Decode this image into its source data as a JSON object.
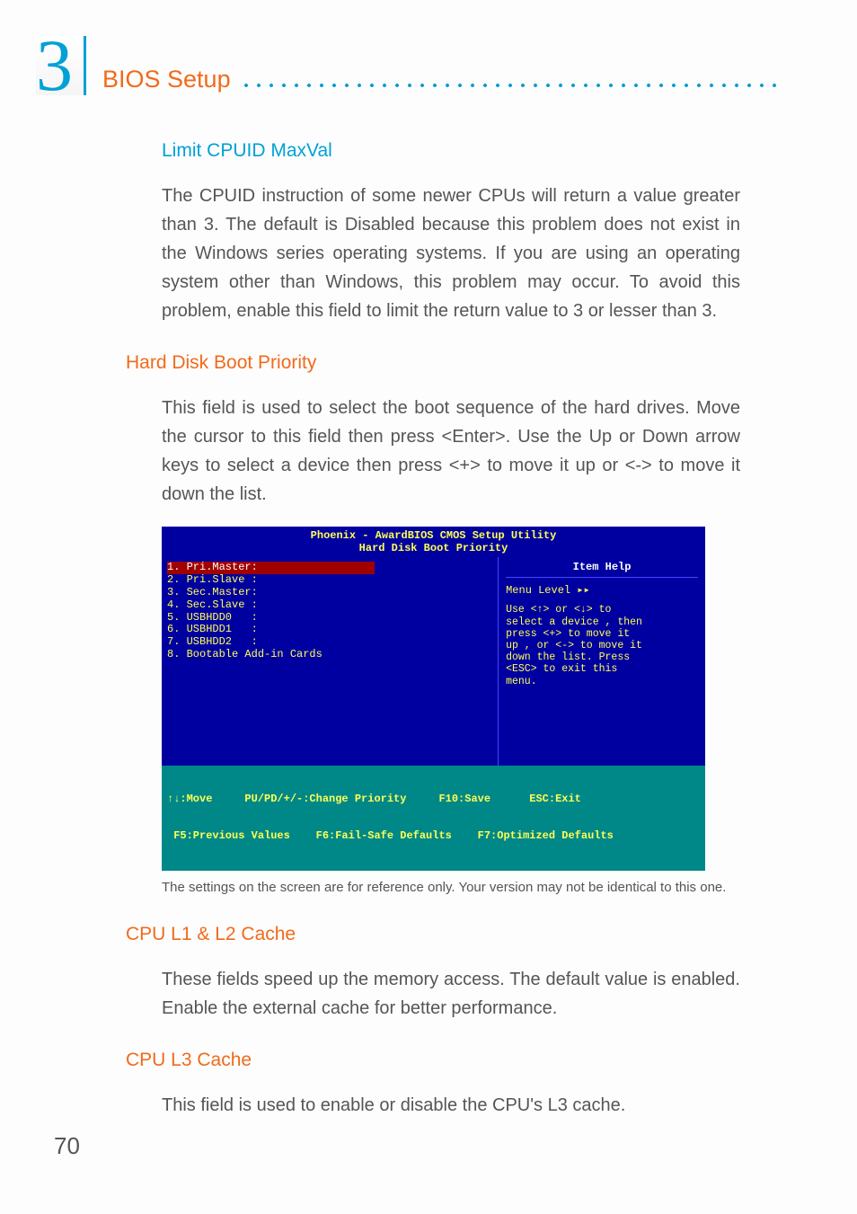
{
  "chapter": {
    "number": "3",
    "title": "BIOS Setup"
  },
  "sections": {
    "limit_cpuid": {
      "title": "Limit CPUID MaxVal",
      "body": "The CPUID instruction of some newer CPUs will return a value greater than 3. The default is Disabled because this problem does not exist in the Windows series operating systems. If you are using an operating system other than Windows, this problem may occur. To avoid this problem, enable this field to limit the return value to 3 or lesser than 3."
    },
    "hard_disk": {
      "title": "Hard Disk Boot Priority",
      "body": "This field is used to select the boot sequence of the hard drives. Move the cursor to this field then press <Enter>. Use the Up or Down arrow keys to select a device then press <+> to move it up or <-> to move it down the list."
    },
    "cpu_l1l2": {
      "title": "CPU L1 & L2 Cache",
      "body": "These fields speed up the memory access. The default value is enabled. Enable the external cache for better performance."
    },
    "cpu_l3": {
      "title": "CPU L3 Cache",
      "body": "This field is used to enable or disable the CPU's L3 cache."
    }
  },
  "bios": {
    "title_line1": "Phoenix - AwardBIOS CMOS Setup Utility",
    "title_line2": "Hard Disk Boot Priority",
    "items": [
      "1. Pri.Master:",
      "2. Pri.Slave :",
      "3. Sec.Master:",
      "4. Sec.Slave :",
      "5. USBHDD0   :",
      "6. USBHDD1   :",
      "7. USBHDD2   :",
      "8. Bootable Add-in Cards"
    ],
    "help_title": "Item Help",
    "menu_level": "Menu Level   ▸▸",
    "help_text": "Use <↑> or <↓> to\nselect a device , then\npress <+> to move it\nup , or <-> to move it\ndown the list. Press\n<ESC> to exit this\nmenu.",
    "footer_line1": "↑↓:Move     PU/PD/+/-:Change Priority     F10:Save      ESC:Exit",
    "footer_line2": " F5:Previous Values    F6:Fail-Safe Defaults    F7:Optimized Defaults"
  },
  "caption": "The settings on the screen are for reference only. Your version may not be identical to this one.",
  "page_number": "70"
}
